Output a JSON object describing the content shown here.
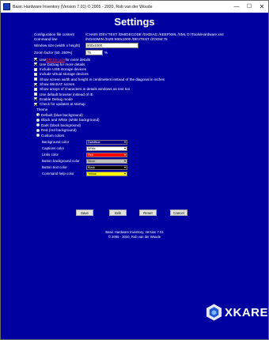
{
  "window": {
    "title": "Basic Hardware Inventory (Version 7.01) © 2005 - 2020, Rob van der Woude",
    "minimize": "—",
    "maximize": "☐",
    "close": "✕"
  },
  "page": {
    "heading": "Settings"
  },
  "config": {
    "file_label": "Configuration file content",
    "file_value": "/CHAIN /DEV:TEST /DMIDECODE /DXDIAG /KEEPXML /XML D:\\Tools\\Hardware.xml",
    "cmdline_label": "Command line",
    "cmdline_value": "/NOADMIN /SIZE:800x1000 /DEVTEST /ZOOM:75",
    "winsize_label": "Window size (width x height)",
    "winsize_value": "800x1000",
    "zoom_label": "Zoom factor (50..250%)",
    "zoom_value": "75",
    "zoom_unit": "%"
  },
  "options": [
    {
      "pre": "Use ",
      "link": "DMIDecode",
      "post": " for more details",
      "checked": true
    },
    {
      "pre": "Use DxDiag for more details",
      "link": "",
      "post": "",
      "checked": true
    },
    {
      "pre": "Include USB storage devices",
      "link": "",
      "post": "",
      "checked": false
    },
    {
      "pre": "Include virtual storage devices",
      "link": "",
      "post": "",
      "checked": false
    },
    {
      "pre": "Show screen width and height in centimeters instead of the diagonal in inches",
      "link": "",
      "post": "",
      "checked": false
    },
    {
      "pre": "Show WinSAT scores",
      "link": "",
      "post": "",
      "checked": true
    },
    {
      "pre": "Show arrays of characters in details windows as text too",
      "link": "",
      "post": "",
      "checked": false
    },
    {
      "pre": "Use default browser instead of IE",
      "link": "",
      "post": "",
      "checked": false
    },
    {
      "pre": "Enable Debug mode",
      "link": "",
      "post": "",
      "checked": true
    },
    {
      "pre": "Check for updates at startup",
      "link": "",
      "post": "",
      "checked": true
    }
  ],
  "theme": {
    "label": "Theme",
    "choices": [
      {
        "label": "Default (blue background)",
        "selected": true
      },
      {
        "label": "Black and White (white background)",
        "selected": false
      },
      {
        "label": "Dark (black background)",
        "selected": false
      },
      {
        "label": "Red (red background)",
        "selected": false
      },
      {
        "label": "Custom colors",
        "selected": false
      }
    ]
  },
  "colors": [
    {
      "label": "Background color",
      "value": "DarkBlue",
      "bg": "#00008b",
      "fg": "#ffffff"
    },
    {
      "label": "Captions color",
      "value": "White",
      "bg": "#ffffff",
      "fg": "#000000"
    },
    {
      "label": "Links color",
      "value": "Red",
      "bg": "#ff0000",
      "fg": "#ffffff"
    },
    {
      "label": "Button background color",
      "value": "Silver",
      "bg": "#c0c0c0",
      "fg": "#000000"
    },
    {
      "label": "Button text color",
      "value": "Black",
      "bg": "#000000",
      "fg": "#ffffff"
    },
    {
      "label": "Command help color",
      "value": "Yellow",
      "bg": "#ffff00",
      "fg": "#000000"
    }
  ],
  "buttons": {
    "save": "Save",
    "edit": "Edit",
    "reset": "Reset",
    "cancel": "Cancel"
  },
  "footer": {
    "line1": "Basic Hardware Inventory,  Version 7.01",
    "line2": "© 2005 - 2020, Rob van der Woude"
  },
  "logo": {
    "text": "XKARE",
    "icon": "xkare-logo-icon"
  }
}
